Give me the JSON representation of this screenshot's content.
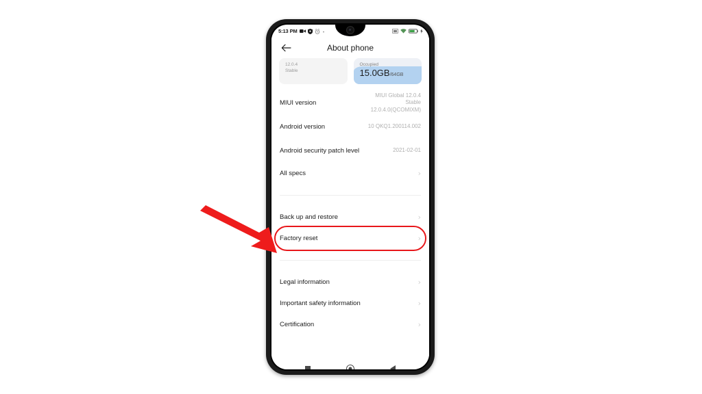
{
  "status_bar": {
    "clock": "5:13 PM",
    "left_icons": [
      "video-camera-icon",
      "shield-icon",
      "alarm-icon",
      "dot-icon"
    ],
    "right_icons": [
      "cast-icon",
      "wifi-icon",
      "battery-icon",
      "charging-bolt-icon"
    ]
  },
  "app_bar": {
    "back_icon": "arrow-left-icon",
    "title": "About phone"
  },
  "cards": {
    "version": {
      "line1": "12.0.4",
      "line2": "Stable"
    },
    "storage": {
      "caption": "Occupied",
      "value": "15.0GB",
      "total": "/64GB"
    }
  },
  "info_rows": [
    {
      "label": "MIUI version",
      "value": "MIUI Global 12.0.4\nStable\n12.0.4.0(QCOMIXM)"
    },
    {
      "label": "Android version",
      "value": "10 QKQ1.200114.002"
    },
    {
      "label": "Android security patch level",
      "value": "2021-02-01"
    }
  ],
  "nav_rows_group1": [
    {
      "label": "All specs",
      "chevron": "›"
    }
  ],
  "nav_rows_group2": [
    {
      "label": "Back up and restore",
      "chevron": "›"
    },
    {
      "label": "Factory reset",
      "chevron": "›",
      "highlighted": true
    }
  ],
  "nav_rows_group3": [
    {
      "label": "Legal information",
      "chevron": "›"
    },
    {
      "label": "Important safety information",
      "chevron": "›"
    },
    {
      "label": "Certification",
      "chevron": "›"
    }
  ],
  "nav_bar": {
    "recents": "recents-square-icon",
    "home": "home-circle-icon",
    "back": "back-triangle-icon"
  },
  "annotation": {
    "arrow_color": "#ee1c1c",
    "highlight_color": "#e8161a",
    "target": "Factory reset"
  },
  "colors": {
    "accent_blue": "#b3d2f0",
    "annotation_red": "#ee1c1c",
    "background": "#ffffff",
    "frame": "#1b1b1b"
  }
}
